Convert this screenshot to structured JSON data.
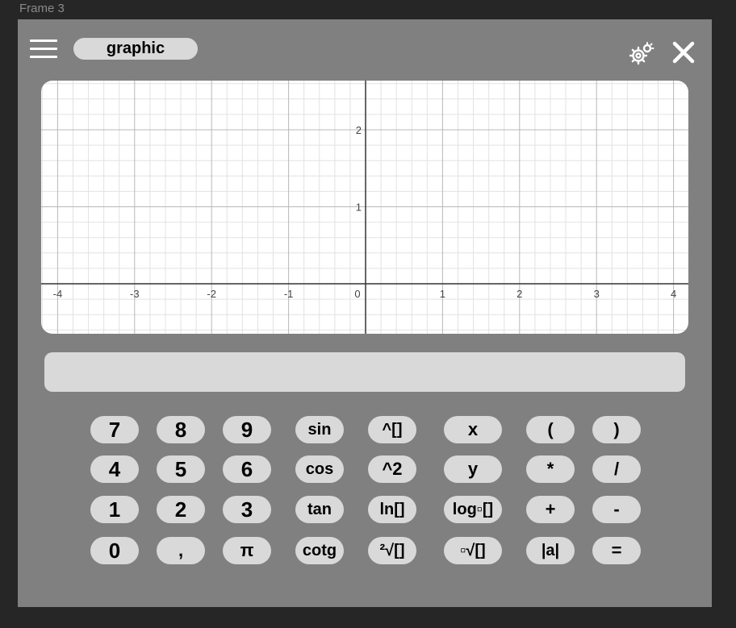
{
  "frame": {
    "label": "Frame 3"
  },
  "header": {
    "menu_icon": "hamburger-menu-icon",
    "mode_label": "graphic",
    "settings_icon": "gear-icon",
    "close_icon": "close-icon"
  },
  "graph": {
    "x_range": [
      -4,
      4
    ],
    "y_range": [
      -0.65,
      2.65
    ],
    "x_ticks": [
      "-4",
      "-3",
      "-2",
      "-1",
      "0",
      "1",
      "2",
      "3",
      "4"
    ],
    "y_ticks": [
      "1",
      "2"
    ],
    "grid": true,
    "minor_divisions": 5
  },
  "display": {
    "value": ""
  },
  "keypad": {
    "rows": [
      [
        {
          "label": "7",
          "name": "key-7"
        },
        {
          "label": "8",
          "name": "key-8"
        },
        {
          "label": "9",
          "name": "key-9"
        },
        {
          "label": "sin",
          "name": "key-sin"
        },
        {
          "label": "^[]",
          "name": "key-power-box"
        },
        {
          "label": "x",
          "name": "key-x"
        },
        {
          "label": "(",
          "name": "key-open-paren"
        },
        {
          "label": ")",
          "name": "key-close-paren"
        }
      ],
      [
        {
          "label": "4",
          "name": "key-4"
        },
        {
          "label": "5",
          "name": "key-5"
        },
        {
          "label": "6",
          "name": "key-6"
        },
        {
          "label": "cos",
          "name": "key-cos"
        },
        {
          "label": "^2",
          "name": "key-square"
        },
        {
          "label": "y",
          "name": "key-y"
        },
        {
          "label": "*",
          "name": "key-multiply"
        },
        {
          "label": "/",
          "name": "key-divide"
        }
      ],
      [
        {
          "label": "1",
          "name": "key-1"
        },
        {
          "label": "2",
          "name": "key-2"
        },
        {
          "label": "3",
          "name": "key-3"
        },
        {
          "label": "tan",
          "name": "key-tan"
        },
        {
          "label": "ln[]",
          "name": "key-ln"
        },
        {
          "label": "log▫[]",
          "name": "key-log"
        },
        {
          "label": "+",
          "name": "key-plus"
        },
        {
          "label": "-",
          "name": "key-minus"
        }
      ],
      [
        {
          "label": "0",
          "name": "key-0"
        },
        {
          "label": ",",
          "name": "key-comma"
        },
        {
          "label": "π",
          "name": "key-pi"
        },
        {
          "label": "cotg",
          "name": "key-cotg"
        },
        {
          "label": "²√[]",
          "name": "key-sqrt"
        },
        {
          "label": "▫√[]",
          "name": "key-nth-root"
        },
        {
          "label": "|a|",
          "name": "key-abs"
        },
        {
          "label": "=",
          "name": "key-equals"
        }
      ]
    ]
  }
}
